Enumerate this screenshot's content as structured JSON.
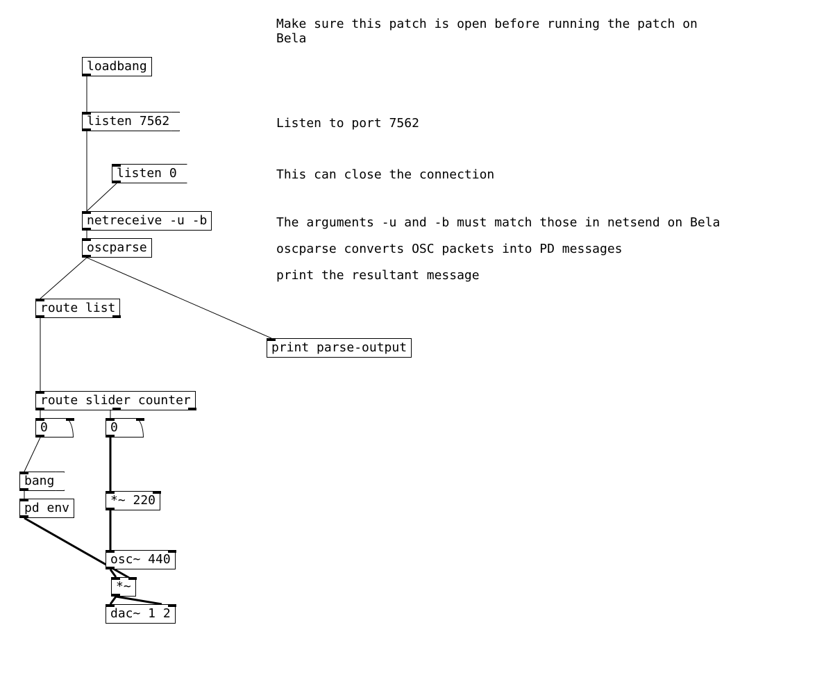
{
  "comments": {
    "intro": "Make sure this patch is open before running the patch on\nBela",
    "listen": "Listen to port 7562",
    "close": "This can close the connection",
    "netrecv": "The arguments -u and -b must match those in netsend on Bela",
    "oscparse": "oscparse converts OSC packets into PD messages",
    "print": "print the resultant message"
  },
  "boxes": {
    "loadbang": "loadbang",
    "listen7562": "listen 7562",
    "listen0": "listen 0",
    "netreceive": "netreceive -u -b",
    "oscparse": "oscparse",
    "routelist": "route list",
    "printparse": "print parse-output",
    "routeslider": "route slider counter",
    "num1": "0",
    "num2": "0",
    "bang": "bang",
    "pdenv": "pd env",
    "mul220": "*~ 220",
    "osc440": "osc~ 440",
    "mul": "*~",
    "dac": "dac~ 1 2"
  }
}
